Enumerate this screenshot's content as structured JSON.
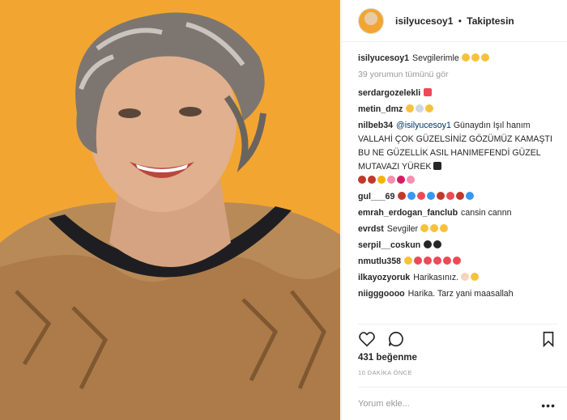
{
  "header": {
    "username": "isilyucesoy1",
    "separator": "•",
    "follow_label": "Takiptesin"
  },
  "caption": {
    "username": "isilyucesoy1",
    "text": "Sevgilerimle"
  },
  "view_all_comments": "39 yorumun tümünü gör",
  "comments": [
    {
      "username": "serdargozelekli",
      "text": ""
    },
    {
      "username": "metin_dmz",
      "text": ""
    },
    {
      "username": "nilbeb34",
      "mention": "@isilyucesoy1",
      "text": "Günaydın Işıl hanım VALLAHİ ÇOK GÜZELSİNİZ GÖZÜMÜZ KAMAŞTI BU NE GÜZELLİK ASIL HANIMEFENDİ GÜZEL MUTAVAZI YÜREK"
    },
    {
      "username": "gul___69",
      "text": ""
    },
    {
      "username": "emrah_erdogan_fanclub",
      "text": "cansin cannn"
    },
    {
      "username": "evrdst",
      "text": "Sevgiler"
    },
    {
      "username": "serpil__coskun",
      "text": ""
    },
    {
      "username": "nmutlu358",
      "text": ""
    },
    {
      "username": "ilkayozyoruk",
      "text": "Harikasınız."
    },
    {
      "username": "niigggoooo",
      "text": "Harika. Tarz yani maasallah"
    }
  ],
  "likes": "431 beğenme",
  "time": "10 DAKİKA ÖNCE",
  "add_comment_placeholder": "Yorum ekle...",
  "more_icon": "•••",
  "colors": {
    "background_photo": "#f2a631",
    "heart": "#ed4956",
    "blue_heart": "#3897f0"
  }
}
